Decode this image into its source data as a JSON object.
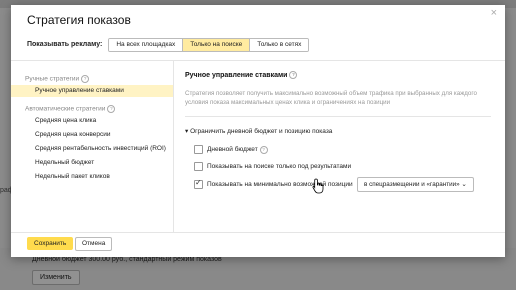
{
  "dialog": {
    "title": "Стратегия показов",
    "close_icon": "×"
  },
  "show_ads": {
    "label": "Показывать рекламу:",
    "options": [
      "На всех площадках",
      "Только на поиске",
      "Только в сетях"
    ],
    "selected": "Только на поиске"
  },
  "strategies": {
    "manual_header": "Ручные стратегии",
    "manual_items": [
      "Ручное управление ставками"
    ],
    "auto_header": "Автоматические стратегии",
    "auto_items": [
      "Средняя цена клика",
      "Средняя цена конверсии",
      "Средняя рентабельность инвестиций (ROI)",
      "Недельный бюджет",
      "Недельный пакет кликов"
    ],
    "selected": "Ручное управление ставками"
  },
  "detail": {
    "title": "Ручное управление ставками",
    "description": "Стратегия позволяет получить максимально возможный объем трафика при выбранных для каждого условия показа максимальных ценах клика и ограничениях на позиции",
    "limit_toggle": "Ограничить дневной бюджет и позицию показа",
    "options": [
      {
        "label": "Дневной бюджет",
        "checked": false
      },
      {
        "label": "Показывать на поиске только под результатами",
        "checked": false
      },
      {
        "label": "Показывать на минимально возможной позиции",
        "checked": true
      }
    ],
    "position_select": "в спецразмещении и «гарантии»"
  },
  "footer": {
    "save": "Сохранить",
    "cancel": "Отмена"
  },
  "background": {
    "side_fragment": "рафи",
    "budget_text": "Дневной бюджет 300.00 руб., стандартный режим показов",
    "change_button": "Изменить"
  },
  "colors": {
    "accent": "#ffdb4d",
    "selected_bg": "#fff3c4",
    "segment_active": "#ffeba0"
  }
}
